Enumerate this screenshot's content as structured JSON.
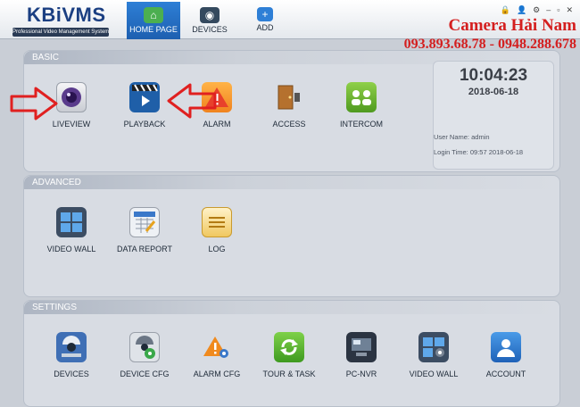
{
  "app": {
    "logo_title": "KBiVMS",
    "logo_subtitle": "Professional Video Management System"
  },
  "nav": {
    "tabs": [
      {
        "label": "HOME PAGE",
        "icon": "home-icon",
        "active": true
      },
      {
        "label": "DEVICES",
        "icon": "devices-icon"
      },
      {
        "label": "ADD",
        "icon": "add-icon"
      }
    ]
  },
  "promo": {
    "name": "Camera Hải Nam",
    "phones": "093.893.68.78 - 0948.288.678"
  },
  "basic": {
    "title": "BASIC",
    "items": [
      {
        "label": "LIVEVIEW",
        "icon": "camera-lens-icon"
      },
      {
        "label": "PLAYBACK",
        "icon": "playback-clapper-icon"
      },
      {
        "label": "ALARM",
        "icon": "alarm-warning-icon"
      },
      {
        "label": "ACCESS",
        "icon": "door-access-icon"
      },
      {
        "label": "INTERCOM",
        "icon": "intercom-icon"
      }
    ]
  },
  "clock": {
    "time": "10:04:23",
    "date": "2018-06-18",
    "user_label": "User Name:",
    "user": "admin",
    "login_label": "Login Time:",
    "login": "09:57 2018-06-18"
  },
  "advanced": {
    "title": "ADVANCED",
    "items": [
      {
        "label": "VIDEO WALL",
        "icon": "video-wall-icon"
      },
      {
        "label": "DATA REPORT",
        "icon": "data-report-icon"
      },
      {
        "label": "LOG",
        "icon": "log-icon"
      }
    ]
  },
  "settings": {
    "title": "SETTINGS",
    "items": [
      {
        "label": "DEVICES",
        "icon": "dome-camera-icon"
      },
      {
        "label": "DEVICE CFG",
        "icon": "device-config-icon"
      },
      {
        "label": "ALARM CFG",
        "icon": "alarm-config-icon"
      },
      {
        "label": "TOUR & TASK",
        "icon": "tour-task-icon"
      },
      {
        "label": "PC-NVR",
        "icon": "pc-nvr-icon"
      },
      {
        "label": "VIDEO WALL",
        "icon": "video-wall-settings-icon"
      },
      {
        "label": "ACCOUNT",
        "icon": "account-icon"
      }
    ]
  },
  "colors": {
    "accent": "#1d5fb0",
    "promo_red": "#d41f1f",
    "arrow_red": "#e02020"
  }
}
